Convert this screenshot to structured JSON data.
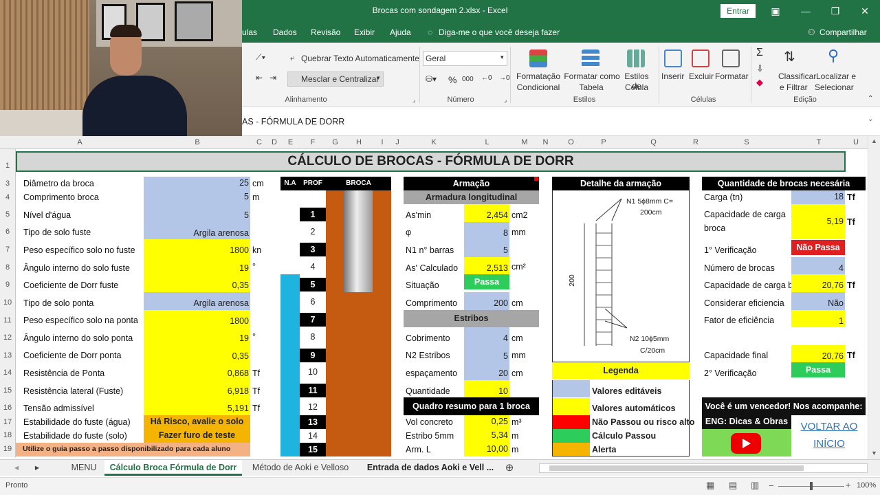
{
  "window": {
    "title": "Brocas com sondagem 2.xlsx  -  Excel",
    "signin": "Entrar"
  },
  "menu": {
    "formulas": "ulas",
    "dados": "Dados",
    "revisao": "Revisão",
    "exibir": "Exibir",
    "ajuda": "Ajuda",
    "tell": "Diga-me o que você deseja fazer",
    "share": "Compartilhar"
  },
  "ribbon": {
    "wrap": "Quebrar Texto Automaticamente",
    "merge": "Mesclar e Centralizar",
    "align_group": "Alinhamento",
    "number_format": "Geral",
    "number_group": "Número",
    "cond": "Formatação",
    "cond2": "Condicional",
    "fmt_table": "Formatar como",
    "fmt_table2": "Tabela",
    "cell_styles": "Estilos de",
    "cell_styles2": "Célula",
    "styles_group": "Estilos",
    "insert": "Inserir",
    "delete": "Excluir",
    "format": "Formatar",
    "cells_group": "Células",
    "sort": "Classificar",
    "sort2": "e Filtrar",
    "find": "Localizar e",
    "find2": "Selecionar",
    "edit_group": "Edição"
  },
  "formula": {
    "text": "AS - FÓRMULA DE DORR"
  },
  "columns": [
    "A",
    "B",
    "C",
    "D",
    "E",
    "F",
    "G",
    "H",
    "I",
    "J",
    "K",
    "L",
    "M",
    "N",
    "O",
    "P",
    "Q",
    "R",
    "S",
    "T",
    "U"
  ],
  "rows": [
    "1",
    "3",
    "4",
    "5",
    "6",
    "7",
    "8",
    "9",
    "10",
    "11",
    "12",
    "13",
    "14",
    "15",
    "16",
    "17",
    "18",
    "19"
  ],
  "sheet": {
    "title": "CÁLCULO DE BROCAS - FÓRMULA DE DORR",
    "left": [
      {
        "label": "Diâmetro da broca",
        "value": "25",
        "unit": "cm"
      },
      {
        "label": "Comprimento broca",
        "value": "5",
        "unit": "m"
      },
      {
        "label": "Nível d'água",
        "value": "5",
        "unit": ""
      },
      {
        "label": "Tipo de solo fuste",
        "value": "Argila arenosa",
        "unit": ""
      },
      {
        "label": "Peso específico solo no  fuste",
        "value": "1800",
        "unit": "kn"
      },
      {
        "label": "Ângulo interno do solo fuste",
        "value": "19",
        "unit": "°"
      },
      {
        "label": "Coeficiente de Dorr fuste",
        "value": "0,35",
        "unit": ""
      },
      {
        "label": "Tipo de solo ponta",
        "value": "Argila arenosa",
        "unit": ""
      },
      {
        "label": "Peso específico solo na ponta",
        "value": "1800",
        "unit": ""
      },
      {
        "label": "Ângulo interno do solo ponta",
        "value": "19",
        "unit": "°"
      },
      {
        "label": "Coeficiente de Dorr ponta",
        "value": "0,35",
        "unit": ""
      },
      {
        "label": "Resistência de Ponta",
        "value": "0,868",
        "unit": "Tf"
      },
      {
        "label": "Resistência lateral (Fuste)",
        "value": "6,918",
        "unit": "Tf"
      },
      {
        "label": "Tensão admissível",
        "value": "5,191",
        "unit": "Tf"
      },
      {
        "label": "Estabilidade do fuste (água)",
        "value": "Há Risco, avalie o solo",
        "unit": ""
      },
      {
        "label": "Estabilidade do fuste (solo)",
        "value": "Fazer furo de teste",
        "unit": ""
      }
    ],
    "guide": "Utilize o guia passo a passo disponibilizado para cada aluno",
    "profile": {
      "na": "N.A",
      "prof": "PROF",
      "broca": "BROCA",
      "depths": [
        "1",
        "2",
        "3",
        "4",
        "5",
        "6",
        "7",
        "8",
        "9",
        "10",
        "11",
        "12",
        "13",
        "14",
        "15"
      ]
    },
    "armacao": {
      "header": "Armação",
      "long": "Armadura longitudinal",
      "rows": [
        {
          "label": "As'min",
          "value": "2,454",
          "unit": "cm2"
        },
        {
          "label": "φ",
          "value": "8",
          "unit": "mm"
        },
        {
          "label": "N1 n° barras",
          "value": "5",
          "unit": ""
        },
        {
          "label": "As' Calculado",
          "value": "2,513",
          "unit": "cm²"
        },
        {
          "label": "Situação",
          "value": "Passa",
          "unit": ""
        },
        {
          "label": "Comprimento",
          "value": "200",
          "unit": "cm"
        }
      ],
      "estribos": "Estribos",
      "rows2": [
        {
          "label": "Cobrimento",
          "value": "4",
          "unit": "cm"
        },
        {
          "label": "N2 Estribos",
          "value": "5",
          "unit": "mm"
        },
        {
          "label": "espaçamento",
          "value": "20",
          "unit": "cm"
        },
        {
          "label": "Quantidade",
          "value": "10",
          "unit": ""
        }
      ],
      "resumo": "Quadro resumo para 1 broca",
      "rows3": [
        {
          "label": "Vol concreto",
          "value": "0,25",
          "unit": "m³"
        },
        {
          "label": "Estribo 5mm",
          "value": "5,34",
          "unit": "m"
        },
        {
          "label": "Arm. L",
          "value": "10,00",
          "unit": "m"
        }
      ]
    },
    "detalhe": {
      "header": "Detalhe da armação",
      "n1": "N1  5ϕ8mm C=",
      "n1b": "200cm",
      "dim": "200",
      "n2": "N2  10ϕ5mm",
      "n2b": "C/20cm"
    },
    "legenda": {
      "header": "Legenda",
      "items": [
        "Valores editáveis",
        "Valores automáticos",
        "Não Passou ou risco alto",
        "Cálculo Passou",
        "Alerta"
      ]
    },
    "qtd": {
      "header": "Quantidade de brocas necesária",
      "rows": [
        {
          "label": "Carga (tn)",
          "value": "18",
          "unit": "Tf"
        },
        {
          "label": "Capacidade de carga",
          "label2": "broca",
          "value": "5,19",
          "unit": "Tf"
        },
        {
          "label": "1° Verificação",
          "value": "Não Passa",
          "unit": ""
        },
        {
          "label": "Número de brocas",
          "value": "4",
          "unit": ""
        },
        {
          "label": "Capacidade de carga b",
          "value": "20,76",
          "unit": "Tf"
        },
        {
          "label": "Considerar eficiencia",
          "value": "Não",
          "unit": ""
        },
        {
          "label": "Fator de eficiência",
          "value": "1",
          "unit": ""
        },
        {
          "label": "Capacidade final",
          "value": "20,76",
          "unit": "Tf"
        },
        {
          "label": "2° Verificação",
          "value": "Passa",
          "unit": ""
        }
      ],
      "promo": "Você é um vencedor! Nos acompanhe:",
      "eng": "ENG: Dicas & Obras",
      "voltar": "VOLTAR AO",
      "inicio": "INÍCIO"
    }
  },
  "tabs": [
    "MENU",
    "Cálculo Broca Fórmula de Dorr",
    "Método de Aoki e Velloso",
    "Entrada de dados Aoki e Vell ..."
  ],
  "status": {
    "ready": "Pronto",
    "zoom": "100%"
  }
}
